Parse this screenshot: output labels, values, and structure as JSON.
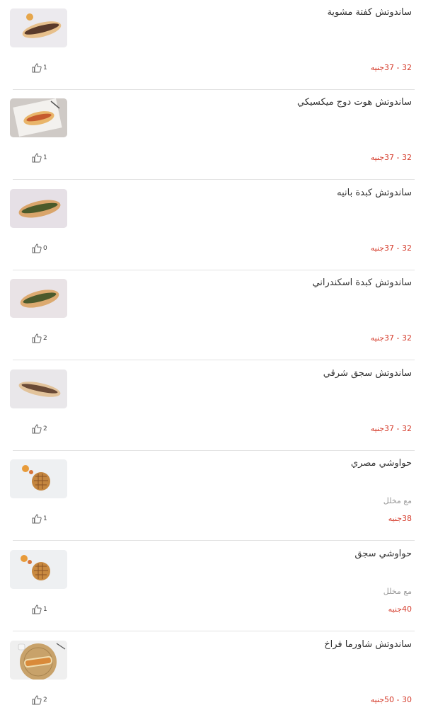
{
  "items": [
    {
      "name": "ساندوتش كفتة مشوية",
      "description": "",
      "price": "32 - 37جنيه",
      "likes": "1",
      "image": "sandwich-kofta"
    },
    {
      "name": "ساندوتش هوت دوج ميكسيكي",
      "description": "",
      "price": "32 - 37جنيه",
      "likes": "1",
      "image": "sandwich-hotdog"
    },
    {
      "name": "ساندوتش كبدة بانيه",
      "description": "",
      "price": "32 - 37جنيه",
      "likes": "0",
      "image": "sandwich-liver-pane"
    },
    {
      "name": "ساندوتش كبدة اسكندراني",
      "description": "",
      "price": "32 - 37جنيه",
      "likes": "2",
      "image": "sandwich-liver-alex"
    },
    {
      "name": "ساندوتش سجق شرقي",
      "description": "",
      "price": "32 - 37جنيه",
      "likes": "2",
      "image": "sandwich-sausage"
    },
    {
      "name": "حواوشي مصري",
      "description": "مع مخلل",
      "price": "38جنيه",
      "likes": "1",
      "image": "hawawshi"
    },
    {
      "name": "حواوشي سجق",
      "description": "مع مخلل",
      "price": "40جنيه",
      "likes": "1",
      "image": "hawawshi-sausage"
    },
    {
      "name": "ساندوتش شاورما فراخ",
      "description": "",
      "price": "30 - 50جنيه",
      "likes": "2",
      "image": "shawarma-chicken"
    }
  ],
  "icons": {
    "like": "thumbs-up-icon"
  },
  "colors": {
    "price": "#d53c2c",
    "separator": "#e2e2e2"
  }
}
